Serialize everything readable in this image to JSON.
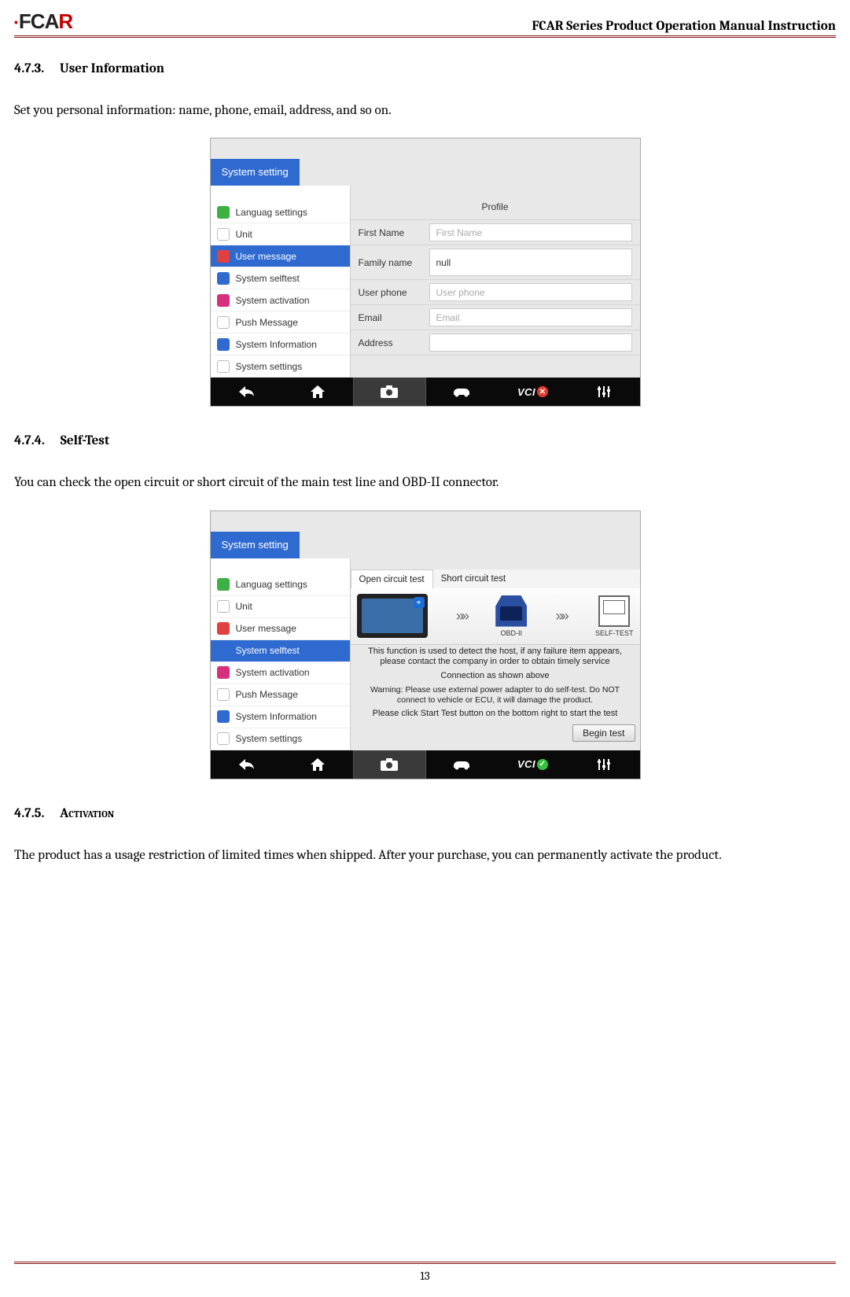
{
  "header": {
    "logo_text": "FCAR",
    "doc_title": "FCAR Series Product  Operation Manual Instruction"
  },
  "sections": {
    "s473": {
      "num": "4.7.3.",
      "title": "User Information",
      "body": "Set you personal information: name, phone, email, address, and so on."
    },
    "s474": {
      "num": "4.7.4.",
      "title": "Self-Test",
      "body": "You can check the open circuit or short circuit of the main test line and OBD-II connector."
    },
    "s475": {
      "num": "4.7.5.",
      "title": "Activation",
      "body": "The product has a usage restriction of limited times when shipped. After your purchase, you can permanently activate the product."
    }
  },
  "screenshot_common": {
    "tab_label": "System setting",
    "sidebar": [
      {
        "label": "Languag settings",
        "icon": "ic-green"
      },
      {
        "label": "Unit",
        "icon": "ic-white"
      },
      {
        "label": "User message",
        "icon": "ic-red"
      },
      {
        "label": "System selftest",
        "icon": "ic-blue"
      },
      {
        "label": "System activation",
        "icon": "ic-pink"
      },
      {
        "label": "Push Message",
        "icon": "ic-gray"
      },
      {
        "label": "System Information",
        "icon": "ic-blue"
      },
      {
        "label": "System settings",
        "icon": "ic-lines"
      }
    ],
    "nav_vci": "VCI"
  },
  "shot1": {
    "active_index": 2,
    "profile_heading": "Profile",
    "fields": [
      {
        "label": "First Name",
        "value": "First Name",
        "placeholder": true
      },
      {
        "label": "Family name",
        "value": "null",
        "placeholder": false,
        "tall": true
      },
      {
        "label": "User phone",
        "value": "User phone",
        "placeholder": true
      },
      {
        "label": "Email",
        "value": "Email",
        "placeholder": true
      },
      {
        "label": "Address",
        "value": "",
        "placeholder": true
      }
    ],
    "vci_status": "red"
  },
  "shot2": {
    "active_index": 3,
    "tabs": {
      "open": "Open circuit test",
      "short": "Short circuit test"
    },
    "device": {
      "obd_label": "OBD-II",
      "selftest_label": "SELF-TEST"
    },
    "text1": "This function is used to detect the host, if any failure item appears, please contact the company in order to obtain timely service",
    "text2": "Connection as shown above",
    "text3": "Warning: Please use external power adapter to do self-test. Do NOT connect to vehicle or ECU, it will damage the product.",
    "text4": "Please click Start Test button on the bottom right to start the test",
    "begin_btn": "Begin test",
    "vci_status": "green"
  },
  "page_number": "13"
}
